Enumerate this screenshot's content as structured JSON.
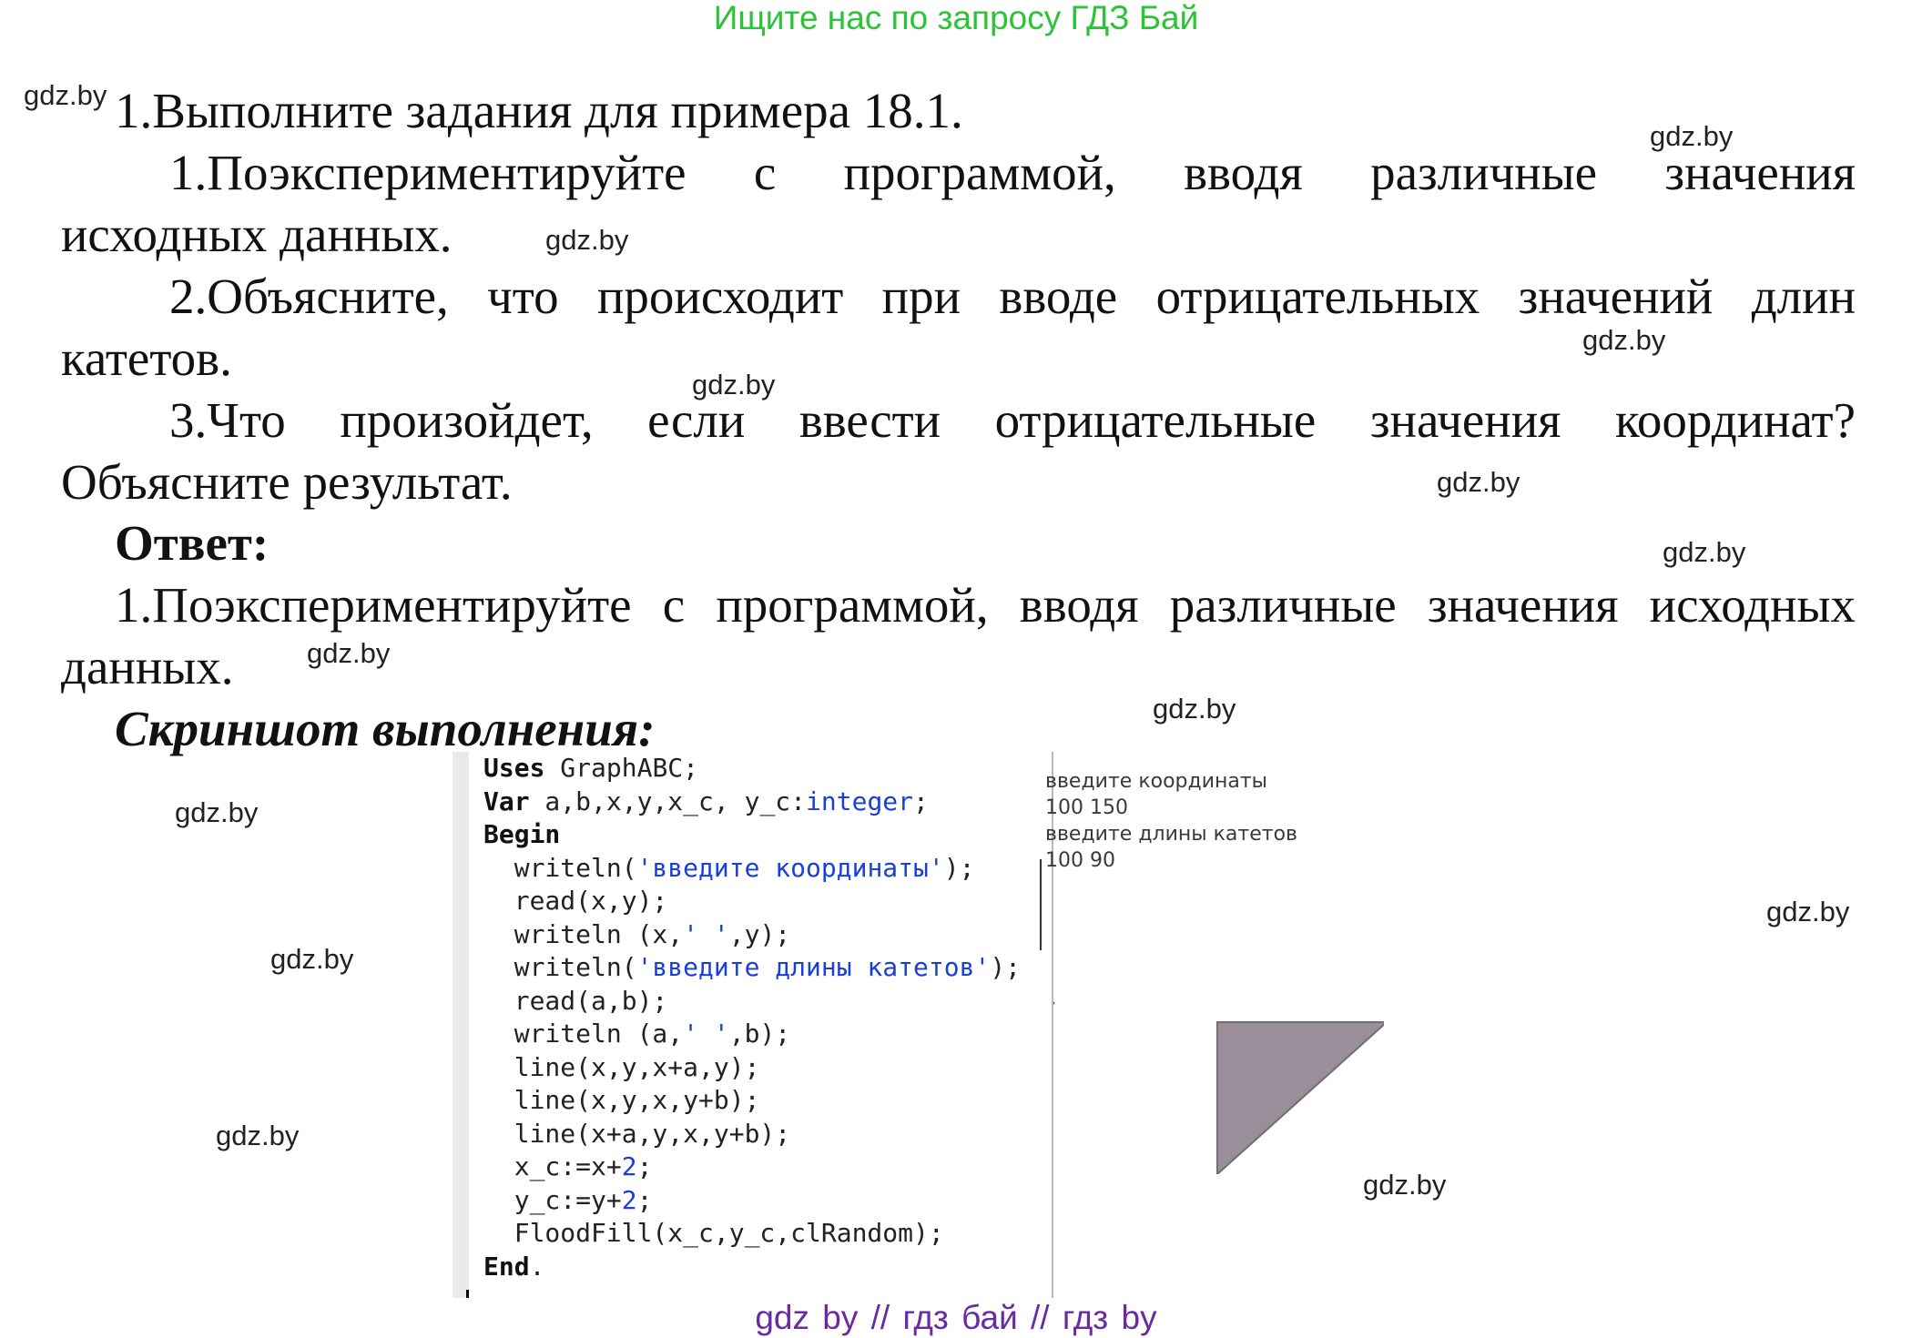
{
  "banner_top": "Ищите нас по запросу ГДЗ Бай",
  "watermark": "gdz.by",
  "task": {
    "heading": "1.Выполните задания для примера 18.1.",
    "item1_line1": "1.Поэкспериментируйте с программой, вводя различные значения",
    "item1_line2": "исходных данных.",
    "item2_line1": "2.Объясните, что происходит при вводе отрицательных значений длин",
    "item2_line2": "катетов.",
    "item3_line1": "3.Что произойдет, если ввести отрицательные значения координат?",
    "item3_line2": "Объясните результат."
  },
  "answer": {
    "label": "Ответ:",
    "line1": "1.Поэкспериментируйте с программой, вводя различные значения исходных",
    "line2": "данных.",
    "screenshot_label": "Скриншот выполнения:"
  },
  "code": {
    "l1_kw": "Uses",
    "l1_rest": " GraphABC;",
    "l2_kw": "Var",
    "l2_mid": " a,b,x,y,x_c, y_c:",
    "l2_type": "integer",
    "l2_end": ";",
    "l3_kw": "Begin",
    "l4_a": "  writeln(",
    "l4_str": "'введите координаты'",
    "l4_b": ");",
    "l5": "  read(x,y);",
    "l6_a": "  writeln (x,",
    "l6_str": "' '",
    "l6_b": ",y);",
    "l7_a": "  writeln(",
    "l7_str": "'введите длины катетов'",
    "l7_b": ");",
    "l8": "  read(a,b);",
    "l9_a": "  writeln (a,",
    "l9_str": "' '",
    "l9_b": ",b);",
    "l10": "  line(x,y,x+a,y);",
    "l11": "  line(x,y,x,y+b);",
    "l12": "  line(x+a,y,x,y+b);",
    "l13_a": "  x_c:=x+",
    "l13_num": "2",
    "l13_b": ";",
    "l14_a": "  y_c:=y+",
    "l14_num": "2",
    "l14_b": ";",
    "l15": "  FloodFill(x_c,y_c,clRandom);",
    "l16_kw": "End",
    "l16_end": "."
  },
  "output": {
    "line1": "введите координаты",
    "line2": "100 150",
    "line3": "введите длины катетов",
    "line4": "100 90"
  },
  "triangle": {
    "fill": "#9b8e9b",
    "stroke": "#6f6f6f"
  },
  "banner_bottom": "gdz by  //  гдз бай  //  гдз by"
}
